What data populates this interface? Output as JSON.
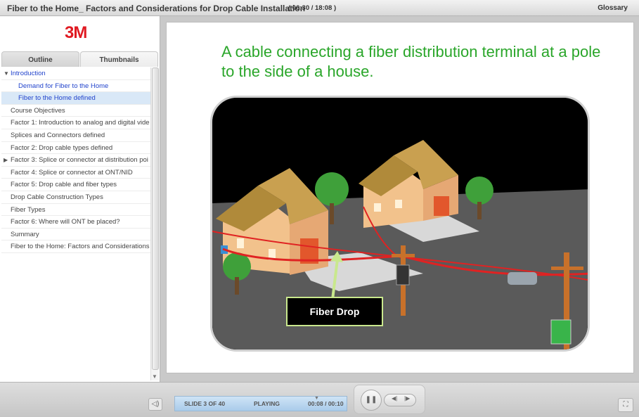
{
  "titlebar": {
    "course_title": "Fiber to the Home_ Factors and Considerations for Drop Cable Installation",
    "duration": "( 00:30 / 18:08 )",
    "glossary_label": "Glossary"
  },
  "sidebar": {
    "logo_text": "3M",
    "tabs": [
      {
        "label": "Outline",
        "active": true
      },
      {
        "label": "Thumbnails",
        "active": false
      }
    ],
    "outline": [
      {
        "label": "Introduction",
        "type": "section",
        "expanded": true
      },
      {
        "label": "Demand for Fiber to the Home",
        "type": "child"
      },
      {
        "label": "Fiber to the Home defined",
        "type": "child",
        "selected": true
      },
      {
        "label": "Course Objectives",
        "type": "item"
      },
      {
        "label": "Factor 1: Introduction to analog and digital vide",
        "type": "item"
      },
      {
        "label": "Splices and Connectors defined",
        "type": "item"
      },
      {
        "label": "Factor 2: Drop cable types defined",
        "type": "item"
      },
      {
        "label": "Factor 3: Splice or connector at distribution poi",
        "type": "item",
        "collapsed": true
      },
      {
        "label": "Factor 4: Splice or connector at ONT/NID",
        "type": "item"
      },
      {
        "label": "Factor 5: Drop cable and fiber types",
        "type": "item"
      },
      {
        "label": "Drop Cable Construction Types",
        "type": "item"
      },
      {
        "label": "Fiber Types",
        "type": "item"
      },
      {
        "label": "Factor 6: Where will ONT be placed?",
        "type": "item"
      },
      {
        "label": "Summary",
        "type": "item"
      },
      {
        "label": "Fiber to the Home: Factors and Considerations",
        "type": "item"
      }
    ]
  },
  "slide": {
    "heading": "A cable connecting a fiber distribution terminal at a pole to the side of a house.",
    "callout": "Fiber Drop"
  },
  "controls": {
    "slide_counter": "SLIDE 3 OF 40",
    "status": "PLAYING",
    "time": "00:08 / 00:10"
  },
  "icons": {
    "volume": "speaker-icon",
    "pause": "pause-icon",
    "prev": "rewind-icon",
    "next": "forward-icon",
    "fullscreen": "fullscreen-icon"
  },
  "colors": {
    "accent_green": "#2aa62a",
    "logo_red": "#e01a22",
    "link_blue": "#2244cc",
    "status_blue": "#a9cbea"
  }
}
